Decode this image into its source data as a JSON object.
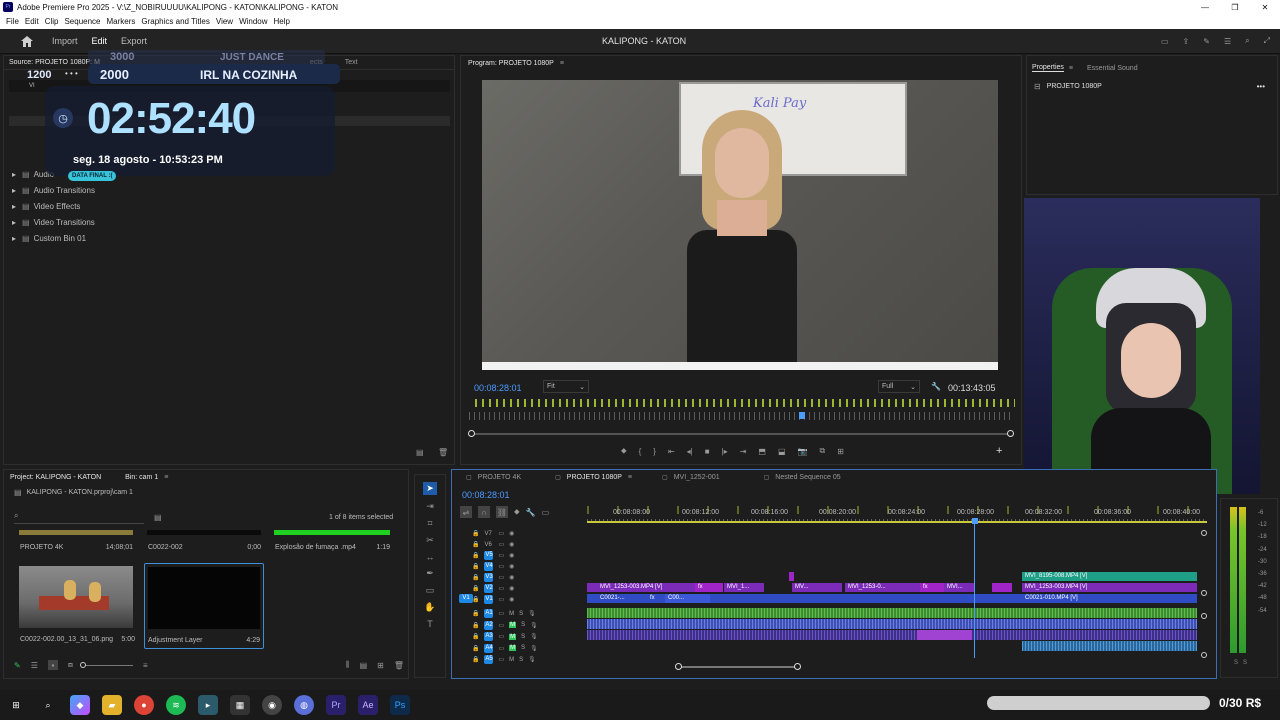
{
  "window": {
    "title": "Adobe Premiere Pro 2025 - V:\\Z_NOBIRUUUU\\KALIPONG - KATON\\KALIPONG - KATON",
    "controls": [
      "—",
      "❐",
      "✕"
    ]
  },
  "menu": [
    "File",
    "Edit",
    "Clip",
    "Sequence",
    "Markers",
    "Graphics and Titles",
    "View",
    "Window",
    "Help"
  ],
  "workspace": {
    "home_icon": "home-icon",
    "tabs": [
      "Import",
      "Edit",
      "Export"
    ],
    "active_tab": "Edit",
    "project_title": "KALIPONG - KATON"
  },
  "source_panel": {
    "tab": "Source: PROJETO 1080P: M",
    "other_tabs": [
      "ects",
      "Text"
    ],
    "bins": [
      "Audio",
      "Audio Transitions",
      "Video Effects",
      "Video Transitions",
      "Custom Bin 01"
    ],
    "search_text": "VI"
  },
  "overlay": {
    "small_top": "1200",
    "dots": "• • •",
    "tier1_value": "3000",
    "tier1_label": "JUST DANCE",
    "tier2_value": "2000",
    "tier2_label": "IRL NA COZINHA",
    "clock": "02:52:40",
    "date": "seg. 18 agosto - 10:53:23 PM",
    "badge": "DATA FINAL :("
  },
  "program_monitor": {
    "tab": "Program: PROJETO 1080P",
    "timecode": "00:08:28:01",
    "fit": "Fit",
    "quality": "Full",
    "duration": "00:13:43:05",
    "whiteboard_text": "Kali Pay"
  },
  "properties_panel": {
    "tabs": [
      "Properties",
      "Essential Sound"
    ],
    "item": "PROJETO 1080P"
  },
  "project_panel": {
    "tab": "Project: KALIPONG - KATON",
    "bin_tab": "Bin: cam 1",
    "file": "KALIPONG - KATON.prproj\\cam 1",
    "selection": "1 of 8 items selected",
    "top_items": [
      {
        "name": "PROJETO 4K",
        "duration": "14;08;01"
      },
      {
        "name": "C0022-002",
        "duration": "0;00"
      },
      {
        "name": "Explosão de fumaça .mp4",
        "duration": "1:19"
      }
    ],
    "thumbs": [
      {
        "name": "C0022-002.00_13_31_06.png",
        "duration": "5:00"
      },
      {
        "name": "Adjustment Layer",
        "duration": "4:29"
      }
    ]
  },
  "timeline": {
    "tabs": [
      "PROJETO 4K",
      "PROJETO 1080P",
      "MVI_1252-001",
      "Nested Sequence 05"
    ],
    "active_tab": "PROJETO 1080P",
    "timecode": "00:08:28:01",
    "ruler": [
      "00:08:08:00",
      "00:08:12:00",
      "00:08:16:00",
      "00:08:20:00",
      "00:08:24:00",
      "00:08:28:00",
      "00:08:32:00",
      "00:08:36:00",
      "00:08:40:00"
    ],
    "video_tracks": [
      "V7",
      "V6",
      "V5",
      "V4",
      "V3",
      "V2",
      "V1"
    ],
    "audio_tracks": [
      "A1",
      "A2",
      "A3",
      "A4",
      "A5"
    ],
    "source_patch_v": "V1",
    "v2_clips": [
      {
        "label": "MVI_1253-003.MP4 [V]"
      },
      {
        "label": "MVI_1..."
      },
      {
        "label": "MV..."
      },
      {
        "label": "MVI_1253-0..."
      },
      {
        "label": "MVI..."
      },
      {
        "label": "MVI_1253-003.MP4 [V]"
      }
    ],
    "v1_clips": [
      {
        "label": "C0021-..."
      },
      {
        "label": "C00..."
      },
      {
        "label": "C0021-010.MP4 [V]"
      }
    ],
    "v3_clip": "MVI_8195-008.MP4 [V]",
    "fx": "fx"
  },
  "meters": {
    "labels": [
      "-6",
      "-12",
      "-18",
      "-24",
      "-30",
      "-36",
      "-42",
      "-48",
      "-54"
    ],
    "solo": "S"
  },
  "taskbar": {
    "donation": "0/30 R$"
  }
}
